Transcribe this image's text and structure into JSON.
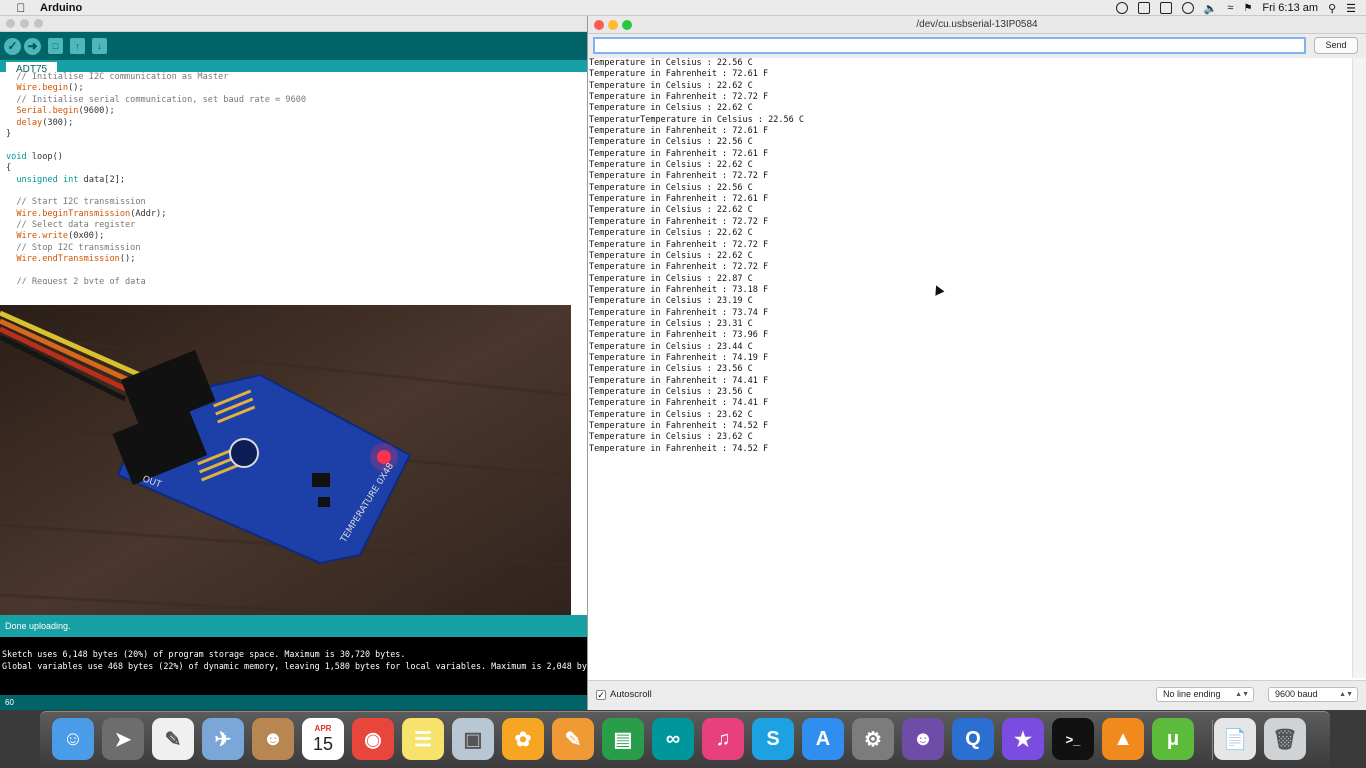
{
  "menubar": {
    "app_name": "Arduino",
    "clock": "Fri 6:13 am"
  },
  "ide": {
    "tab_label": "ADT75",
    "code_lines": [
      "  // Initialise I2C communication as Master",
      "  Wire.begin();",
      "  // Initialise serial communication, set baud rate = 9600",
      "  Serial.begin(9600);",
      "  delay(300);",
      "}",
      "",
      "void loop()",
      "{",
      "  unsigned int data[2];",
      "",
      "  // Start I2C transmission",
      "  Wire.beginTransmission(Addr);",
      "  // Select data register",
      "  Wire.write(0x00);",
      "  // Stop I2C transmission",
      "  Wire.endTransmission();",
      "",
      "  // Request 2 byte of data"
    ],
    "status_text": "Done uploading.",
    "console_lines": [
      "Sketch uses 6,148 bytes (20%) of program storage space. Maximum is 30,720 bytes.",
      "Global variables use 468 bytes (22%) of dynamic memory, leaving 1,580 bytes for local variables. Maximum is 2,048 bytes."
    ],
    "line_number": "60",
    "photo": {
      "board_label": "TEMPERATURE 0X48",
      "out_label": "OUT"
    }
  },
  "serial": {
    "title": "/dev/cu.usbserial-13IP0584",
    "input_value": "",
    "send_label": "Send",
    "output_lines": [
      "Temperature in Celsius : 22.56 C",
      "Temperature in Fahrenheit : 72.61 F",
      "Temperature in Celsius : 22.62 C",
      "Temperature in Fahrenheit : 72.72 F",
      "Temperature in Celsius : 22.62 C",
      "TemperaturTemperature in Celsius : 22.56 C",
      "Temperature in Fahrenheit : 72.61 F",
      "Temperature in Celsius : 22.56 C",
      "Temperature in Fahrenheit : 72.61 F",
      "Temperature in Celsius : 22.62 C",
      "Temperature in Fahrenheit : 72.72 F",
      "Temperature in Celsius : 22.56 C",
      "Temperature in Fahrenheit : 72.61 F",
      "Temperature in Celsius : 22.62 C",
      "Temperature in Fahrenheit : 72.72 F",
      "Temperature in Celsius : 22.62 C",
      "Temperature in Fahrenheit : 72.72 F",
      "Temperature in Celsius : 22.62 C",
      "Temperature in Fahrenheit : 72.72 F",
      "Temperature in Celsius : 22.87 C",
      "Temperature in Fahrenheit : 73.18 F",
      "Temperature in Celsius : 23.19 C",
      "Temperature in Fahrenheit : 73.74 F",
      "Temperature in Celsius : 23.31 C",
      "Temperature in Fahrenheit : 73.96 F",
      "Temperature in Celsius : 23.44 C",
      "Temperature in Fahrenheit : 74.19 F",
      "Temperature in Celsius : 23.56 C",
      "Temperature in Fahrenheit : 74.41 F",
      "Temperature in Celsius : 23.56 C",
      "Temperature in Fahrenheit : 74.41 F",
      "Temperature in Celsius : 23.62 C",
      "Temperature in Fahrenheit : 74.52 F",
      "Temperature in Celsius : 23.62 C",
      "Temperature in Fahrenheit : 74.52 F"
    ],
    "autoscroll_label": "Autoscroll",
    "autoscroll_checked": true,
    "line_ending": "No line ending",
    "baud_rate": "9600 baud"
  },
  "dock": {
    "calendar_month": "APR",
    "calendar_day": "15",
    "items": [
      "finder-icon",
      "launchpad-icon",
      "textedit-icon",
      "preview-icon",
      "contacts-icon",
      "calendar-icon",
      "chrome-icon",
      "notes-icon",
      "image-capture-icon",
      "photos-icon",
      "pages-icon",
      "numbers-icon",
      "arduino-icon",
      "itunes-icon",
      "skype-icon",
      "app-store-icon",
      "system-preferences-icon",
      "github-icon",
      "quicktime-icon",
      "imovie-icon",
      "terminal-icon",
      "vlc-icon",
      "utorrent-icon",
      "python-file-icon",
      "trash-icon"
    ]
  },
  "colors": {
    "arduino_teal": "#006468",
    "arduino_tab": "#17a1a5",
    "code_keyword": "#d35400",
    "code_type": "#00979c"
  }
}
